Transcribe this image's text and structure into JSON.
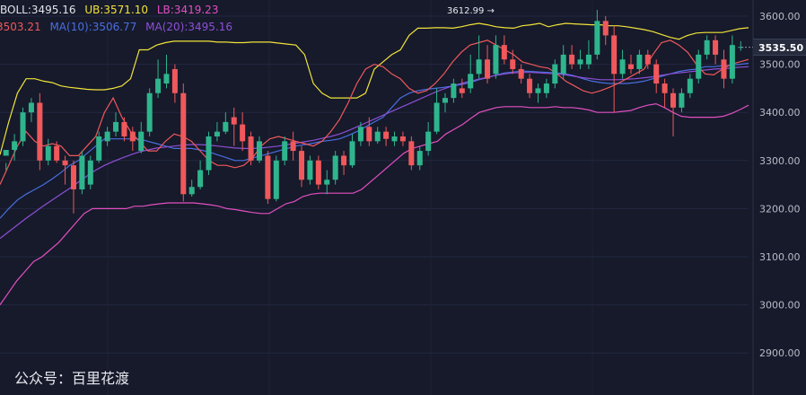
{
  "chart_data": {
    "type": "candlestick",
    "indicators": {
      "boll": {
        "label": "BOLL:",
        "value": "3495.16",
        "color": "#e2e4ea"
      },
      "ub": {
        "label": "UB:",
        "value": "3571.10",
        "color": "#f2e33a"
      },
      "lb": {
        "label": "LB:",
        "value": "3419.23",
        "color": "#e24fc0"
      },
      "ma5": {
        "label": "",
        "value": "3503.21",
        "color": "#f0585b",
        "clipped_prefix": true
      },
      "ma10": {
        "label": "MA(10):",
        "value": "3506.77",
        "color": "#4a6ee0"
      },
      "ma20": {
        "label": "MA(20):",
        "value": "3495.16",
        "color": "#8e4fd6"
      }
    },
    "yaxis_ticks": [
      "3600.00",
      "3500.00",
      "3400.00",
      "3300.00",
      "3200.00",
      "3100.00",
      "3000.00",
      "2900.00"
    ],
    "ylim": [
      2880,
      3625
    ],
    "current_price": "3535.50",
    "max_marker": "3612.99",
    "max_marker_arrow": "→",
    "colors": {
      "up": "#2fb58d",
      "down": "#f0585b",
      "background": "#161a2b",
      "grid": "#232840",
      "axis_text": "#b9bdc8"
    },
    "series": [
      {
        "name": "UB",
        "key": "ub",
        "color": "#f2e33a",
        "values": [
          3312,
          3380,
          3440,
          3470,
          3470,
          3465,
          3462,
          3455,
          3452,
          3450,
          3448,
          3447,
          3447,
          3450,
          3455,
          3470,
          3530,
          3530,
          3540,
          3545,
          3548,
          3548,
          3548,
          3548,
          3548,
          3546,
          3546,
          3545,
          3545,
          3546,
          3546,
          3546,
          3544,
          3542,
          3540,
          3520,
          3460,
          3440,
          3430,
          3430,
          3430,
          3430,
          3440,
          3490,
          3505,
          3520,
          3530,
          3560,
          3575,
          3575,
          3576,
          3576,
          3575,
          3578,
          3582,
          3585,
          3582,
          3578,
          3576,
          3575,
          3580,
          3582,
          3585,
          3578,
          3582,
          3585,
          3584,
          3583,
          3582,
          3582,
          3580,
          3580,
          3578,
          3575,
          3572,
          3568,
          3562,
          3556,
          3552,
          3560,
          3565,
          3566,
          3566,
          3566,
          3570,
          3574,
          3576
        ]
      },
      {
        "name": "LB",
        "key": "lb",
        "color": "#e24fc0",
        "values": [
          3000,
          3025,
          3050,
          3070,
          3090,
          3100,
          3115,
          3130,
          3150,
          3170,
          3190,
          3200,
          3200,
          3200,
          3200,
          3200,
          3205,
          3205,
          3208,
          3210,
          3212,
          3212,
          3212,
          3212,
          3210,
          3208,
          3205,
          3200,
          3198,
          3195,
          3192,
          3190,
          3190,
          3200,
          3210,
          3215,
          3225,
          3230,
          3232,
          3232,
          3232,
          3232,
          3232,
          3240,
          3255,
          3270,
          3285,
          3300,
          3315,
          3325,
          3330,
          3335,
          3340,
          3355,
          3365,
          3375,
          3388,
          3400,
          3405,
          3410,
          3412,
          3412,
          3412,
          3410,
          3410,
          3410,
          3412,
          3410,
          3410,
          3408,
          3405,
          3400,
          3400,
          3400,
          3402,
          3404,
          3410,
          3415,
          3418,
          3410,
          3400,
          3392,
          3390,
          3390,
          3390,
          3390,
          3392,
          3398,
          3406,
          3415
        ]
      },
      {
        "name": "MA(10)",
        "key": "ma10",
        "color": "#4a6ee0",
        "values": [
          3180,
          3200,
          3218,
          3230,
          3240,
          3250,
          3262,
          3275,
          3290,
          3300,
          3315,
          3330,
          3345,
          3345,
          3345,
          3345,
          3345,
          3340,
          3335,
          3330,
          3325,
          3325,
          3325,
          3322,
          3318,
          3312,
          3306,
          3300,
          3300,
          3305,
          3310,
          3315,
          3320,
          3325,
          3330,
          3333,
          3336,
          3340,
          3342,
          3345,
          3352,
          3360,
          3370,
          3380,
          3390,
          3410,
          3430,
          3440,
          3445,
          3448,
          3450,
          3452,
          3455,
          3458,
          3462,
          3468,
          3472,
          3478,
          3482,
          3484,
          3486,
          3485,
          3484,
          3483,
          3482,
          3480,
          3476,
          3470,
          3465,
          3462,
          3460,
          3460,
          3460,
          3462,
          3465,
          3470,
          3475,
          3480,
          3485,
          3488,
          3490,
          3495,
          3495,
          3497,
          3498,
          3500,
          3502
        ]
      },
      {
        "name": "MA(20)",
        "key": "ma20",
        "color": "#8e4fd6",
        "values": [
          3138,
          3152,
          3166,
          3180,
          3193,
          3206,
          3218,
          3230,
          3242,
          3255,
          3268,
          3280,
          3290,
          3298,
          3305,
          3312,
          3318,
          3322,
          3326,
          3328,
          3330,
          3332,
          3333,
          3333,
          3332,
          3330,
          3328,
          3326,
          3325,
          3325,
          3326,
          3328,
          3330,
          3333,
          3336,
          3339,
          3342,
          3346,
          3350,
          3355,
          3362,
          3370,
          3378,
          3386,
          3394,
          3402,
          3410,
          3418,
          3426,
          3434,
          3442,
          3449,
          3455,
          3460,
          3465,
          3469,
          3473,
          3477,
          3480,
          3482,
          3483,
          3483,
          3482,
          3481,
          3480,
          3478,
          3475,
          3472,
          3470,
          3468,
          3468,
          3468,
          3469,
          3470,
          3472,
          3474,
          3477,
          3480,
          3482,
          3484,
          3486,
          3488,
          3490,
          3491,
          3492,
          3494,
          3495
        ]
      },
      {
        "name": "MA(5)",
        "key": "ma5",
        "color": "#f0585b",
        "values": [
          3250,
          3290,
          3330,
          3360,
          3340,
          3330,
          3335,
          3330,
          3310,
          3310,
          3330,
          3350,
          3400,
          3430,
          3390,
          3360,
          3340,
          3320,
          3320,
          3340,
          3355,
          3350,
          3340,
          3320,
          3300,
          3290,
          3290,
          3285,
          3290,
          3305,
          3330,
          3345,
          3350,
          3345,
          3340,
          3335,
          3330,
          3340,
          3360,
          3385,
          3420,
          3460,
          3490,
          3500,
          3495,
          3480,
          3470,
          3450,
          3440,
          3445,
          3460,
          3480,
          3505,
          3525,
          3540,
          3545,
          3550,
          3540,
          3530,
          3520,
          3505,
          3500,
          3495,
          3492,
          3480,
          3465,
          3455,
          3445,
          3440,
          3445,
          3452,
          3460,
          3470,
          3480,
          3490,
          3520,
          3545,
          3550,
          3540,
          3525,
          3500,
          3480,
          3478,
          3490,
          3500,
          3505,
          3510
        ]
      }
    ],
    "candles": [
      [
        3310,
        3322,
        3295,
        3280
      ],
      [
        3322,
        3340,
        3355,
        3300
      ],
      [
        3340,
        3400,
        3410,
        3330
      ],
      [
        3400,
        3420,
        3430,
        3380
      ],
      [
        3420,
        3300,
        3440,
        3280
      ],
      [
        3300,
        3330,
        3345,
        3290
      ],
      [
        3330,
        3300,
        3340,
        3295
      ],
      [
        3300,
        3290,
        3310,
        3250
      ],
      [
        3290,
        3240,
        3300,
        3190
      ],
      [
        3240,
        3310,
        3320,
        3230
      ],
      [
        3250,
        3300,
        3310,
        3240
      ],
      [
        3300,
        3350,
        3360,
        3295
      ],
      [
        3340,
        3360,
        3370,
        3330
      ],
      [
        3360,
        3380,
        3400,
        3350
      ],
      [
        3380,
        3350,
        3390,
        3340
      ],
      [
        3360,
        3340,
        3370,
        3320
      ],
      [
        3320,
        3360,
        3380,
        3315
      ],
      [
        3360,
        3440,
        3450,
        3350
      ],
      [
        3440,
        3470,
        3510,
        3430
      ],
      [
        3460,
        3480,
        3520,
        3450
      ],
      [
        3490,
        3440,
        3500,
        3420
      ],
      [
        3440,
        3230,
        3460,
        3215
      ],
      [
        3230,
        3245,
        3260,
        3225
      ],
      [
        3245,
        3280,
        3300,
        3240
      ],
      [
        3280,
        3350,
        3360,
        3270
      ],
      [
        3350,
        3360,
        3380,
        3340
      ],
      [
        3360,
        3380,
        3400,
        3355
      ],
      [
        3390,
        3375,
        3410,
        3330
      ],
      [
        3375,
        3340,
        3400,
        3320
      ],
      [
        3350,
        3300,
        3360,
        3290
      ],
      [
        3300,
        3340,
        3350,
        3295
      ],
      [
        3310,
        3220,
        3320,
        3210
      ],
      [
        3220,
        3300,
        3310,
        3215
      ],
      [
        3300,
        3340,
        3350,
        3290
      ],
      [
        3340,
        3320,
        3360,
        3300
      ],
      [
        3320,
        3260,
        3330,
        3245
      ],
      [
        3260,
        3300,
        3310,
        3250
      ],
      [
        3300,
        3250,
        3310,
        3240
      ],
      [
        3250,
        3260,
        3280,
        3230
      ],
      [
        3260,
        3310,
        3320,
        3250
      ],
      [
        3310,
        3290,
        3320,
        3270
      ],
      [
        3290,
        3340,
        3355,
        3285
      ],
      [
        3340,
        3370,
        3380,
        3330
      ],
      [
        3370,
        3340,
        3390,
        3330
      ],
      [
        3340,
        3360,
        3370,
        3335
      ],
      [
        3360,
        3345,
        3370,
        3330
      ],
      [
        3340,
        3350,
        3360,
        3330
      ],
      [
        3350,
        3340,
        3360,
        3330
      ],
      [
        3340,
        3290,
        3350,
        3280
      ],
      [
        3290,
        3320,
        3330,
        3280
      ],
      [
        3320,
        3360,
        3380,
        3310
      ],
      [
        3360,
        3420,
        3450,
        3355
      ],
      [
        3420,
        3430,
        3440,
        3400
      ],
      [
        3430,
        3460,
        3470,
        3420
      ],
      [
        3450,
        3440,
        3470,
        3430
      ],
      [
        3450,
        3480,
        3520,
        3440
      ],
      [
        3480,
        3510,
        3560,
        3470
      ],
      [
        3510,
        3470,
        3540,
        3460
      ],
      [
        3480,
        3540,
        3560,
        3470
      ],
      [
        3540,
        3510,
        3560,
        3500
      ],
      [
        3510,
        3490,
        3530,
        3480
      ],
      [
        3490,
        3470,
        3500,
        3460
      ],
      [
        3470,
        3440,
        3480,
        3430
      ],
      [
        3440,
        3450,
        3460,
        3420
      ],
      [
        3440,
        3460,
        3470,
        3430
      ],
      [
        3460,
        3500,
        3510,
        3450
      ],
      [
        3480,
        3520,
        3540,
        3470
      ],
      [
        3520,
        3500,
        3540,
        3490
      ],
      [
        3500,
        3510,
        3530,
        3490
      ],
      [
        3500,
        3520,
        3550,
        3490
      ],
      [
        3520,
        3590,
        3613,
        3510
      ],
      [
        3590,
        3560,
        3600,
        3540
      ],
      [
        3560,
        3480,
        3580,
        3400
      ],
      [
        3480,
        3510,
        3530,
        3470
      ],
      [
        3500,
        3490,
        3520,
        3480
      ],
      [
        3490,
        3520,
        3530,
        3480
      ],
      [
        3520,
        3500,
        3530,
        3490
      ],
      [
        3500,
        3460,
        3510,
        3440
      ],
      [
        3460,
        3440,
        3470,
        3410
      ],
      [
        3440,
        3410,
        3450,
        3350
      ],
      [
        3410,
        3440,
        3450,
        3400
      ],
      [
        3440,
        3470,
        3480,
        3430
      ],
      [
        3470,
        3520,
        3530,
        3460
      ],
      [
        3520,
        3550,
        3560,
        3510
      ],
      [
        3550,
        3520,
        3560,
        3500
      ],
      [
        3510,
        3470,
        3530,
        3450
      ],
      [
        3470,
        3540,
        3560,
        3460
      ],
      [
        3536,
        3536,
        3548,
        3528
      ]
    ]
  },
  "watermark": "公众号：百里花渡"
}
